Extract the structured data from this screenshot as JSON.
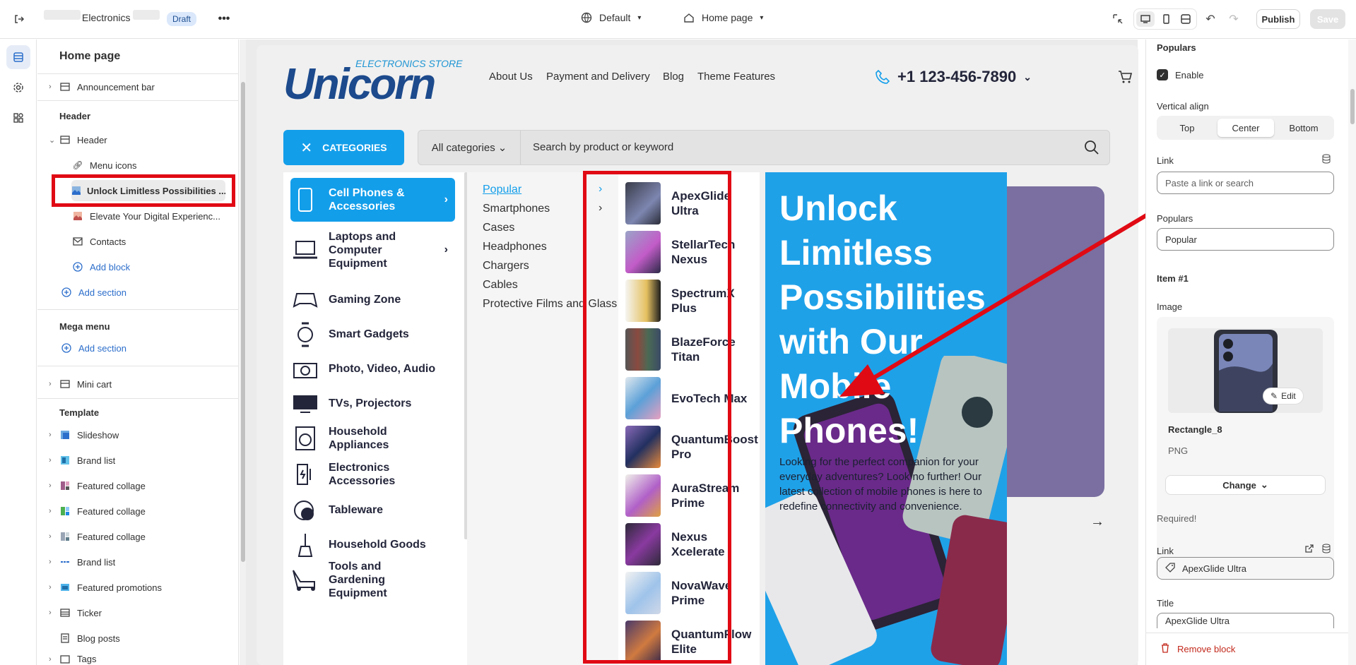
{
  "topbar": {
    "store_name": "Electronics",
    "status_badge": "Draft",
    "theme_selector": "Default",
    "page_selector": "Home page",
    "publish_label": "Publish",
    "save_label": "Save"
  },
  "left_panel": {
    "title": "Home page",
    "announcement_bar": "Announcement bar",
    "header_section_title": "Header",
    "header_item": "Header",
    "header_blocks": [
      "Menu icons",
      "Unlock Limitless Possibilities ...",
      "Elevate Your Digital Experienc...",
      "Contacts"
    ],
    "add_block": "Add block",
    "add_section": "Add section",
    "mega_menu_title": "Mega menu",
    "mega_add_section": "Add section",
    "mini_cart": "Mini cart",
    "template_title": "Template",
    "template_items": [
      "Slideshow",
      "Brand list",
      "Featured collage",
      "Featured collage",
      "Featured collage",
      "Brand list",
      "Featured promotions",
      "Ticker",
      "Blog posts",
      "Tags"
    ]
  },
  "store": {
    "logo_text": "Unicorn",
    "logo_subtitle": "ELECTRONICS STORE",
    "nav": [
      "About Us",
      "Payment and Delivery",
      "Blog",
      "Theme Features"
    ],
    "phone": "+1 123-456-7890",
    "categories_button": "CATEGORIES",
    "search_category": "All categories",
    "search_placeholder": "Search by product or keyword",
    "mega_categories": [
      "Cell Phones & Accessories",
      "Laptops and Computer Equipment",
      "Gaming Zone",
      "Smart Gadgets",
      "Photo, Video, Audio",
      "TVs, Projectors",
      "Household Appliances",
      "Electronics Accessories",
      "Tableware",
      "Household Goods",
      "Tools and Gardening Equipment"
    ],
    "subcategories": [
      "Popular",
      "Smartphones",
      "Cases",
      "Headphones",
      "Chargers",
      "Cables",
      "Protective Films and Glass"
    ],
    "products": [
      "ApexGlide Ultra",
      "StellarTech Nexus",
      "SpectrumX Plus",
      "BlazeForce Titan",
      "EvoTech Max",
      "QuantumBoost Pro",
      "AuraStream Prime",
      "Nexus Xcelerate",
      "NovaWave Prime",
      "QuantumFlow Elite"
    ],
    "banner_title": "Unlock Limitless Possibilities with Our Mobile Phones!",
    "banner_text": "Looking for the perfect companion for your everyday adventures? Look no further! Our latest collection of mobile phones is here to redefine connectivity and convenience."
  },
  "right_panel": {
    "section_title": "Populars",
    "enable_label": "Enable",
    "vertical_align_label": "Vertical align",
    "vertical_align_options": [
      "Top",
      "Center",
      "Bottom"
    ],
    "vertical_align_selected": "Center",
    "link_label": "Link",
    "link_placeholder": "Paste a link or search",
    "populars_label": "Populars",
    "populars_value": "Popular",
    "item_title": "Item #1",
    "image_label": "Image",
    "image_edit": "Edit",
    "image_name": "Rectangle_8",
    "image_type": "PNG",
    "change_label": "Change",
    "required_text": "Required!",
    "item_link_label": "Link",
    "item_link_value": "ApexGlide Ultra",
    "title_label": "Title",
    "title_value": "ApexGlide Ultra",
    "remove_block": "Remove block"
  },
  "colors": {
    "accent": "#139eea",
    "annotation_red": "#e00a14",
    "brand_dark": "#1c4a8c"
  }
}
